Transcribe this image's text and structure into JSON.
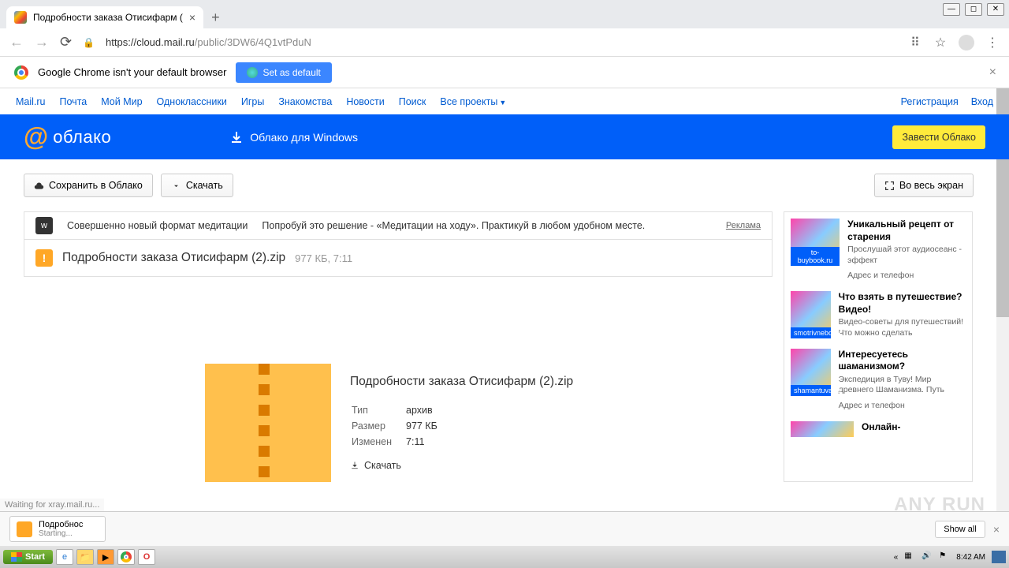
{
  "tab": {
    "title": "Подробности заказа Отисифарм ("
  },
  "url": {
    "host": "https://cloud.mail.ru",
    "path": "/public/3DW6/4Q1vtPduN"
  },
  "infobar": {
    "text": "Google Chrome isn't your default browser",
    "button": "Set as default"
  },
  "portal": {
    "links": [
      "Mail.ru",
      "Почта",
      "Мой Мир",
      "Одноклассники",
      "Игры",
      "Знакомства",
      "Новости",
      "Поиск",
      "Все проекты"
    ],
    "reg": "Регистрация",
    "login": "Вход"
  },
  "header": {
    "logo": "облако",
    "dl": "Облако для Windows",
    "cta": "Завести Облако"
  },
  "actions": {
    "save": "Сохранить в Облако",
    "download": "Скачать",
    "fullscreen": "Во весь экран"
  },
  "adstrip": {
    "icon": "w",
    "t1": "Совершенно новый формат медитации",
    "t2": "Попробуй это решение - «Медитации на ходу». Практикуй в любом удобном месте.",
    "label": "Реклама"
  },
  "file": {
    "name": "Подробности заказа Отисифарм (2).zip",
    "meta": "977 КБ, 7:11"
  },
  "details": {
    "title": "Подробности заказа Отисифарм (2).zip",
    "type_l": "Тип",
    "type_v": "архив",
    "size_l": "Размер",
    "size_v": "977 КБ",
    "mod_l": "Изменен",
    "mod_v": "7:11",
    "download": "Скачать"
  },
  "ads": [
    {
      "tag": "to-buybook.ru",
      "hd": "Уникальный рецепт от старения",
      "sub": "Прослушай этот аудиосеанс - эффект",
      "addr": "Адрес и телефон"
    },
    {
      "tag": "smotrivnebo.ru",
      "hd": "Что взять в путешествие? Видео!",
      "sub": "Видео-советы для путешествий! Что можно сделать",
      "addr": ""
    },
    {
      "tag": "shamantuva.ru",
      "hd": "Интересуетесь шаманизмом?",
      "sub": "Экспедиция в Туву! Мир древнего Шаманизма. Путь",
      "addr": "Адрес и телефон"
    },
    {
      "tag": "",
      "hd": "Онлайн-",
      "sub": "",
      "addr": ""
    }
  ],
  "status": "Waiting for xray.mail.ru...",
  "shelf": {
    "name": "Подробнос",
    "sub": "Starting...",
    "showall": "Show all"
  },
  "taskbar": {
    "start": "Start",
    "time": "8:42 AM"
  },
  "watermark": "ANY RUN"
}
